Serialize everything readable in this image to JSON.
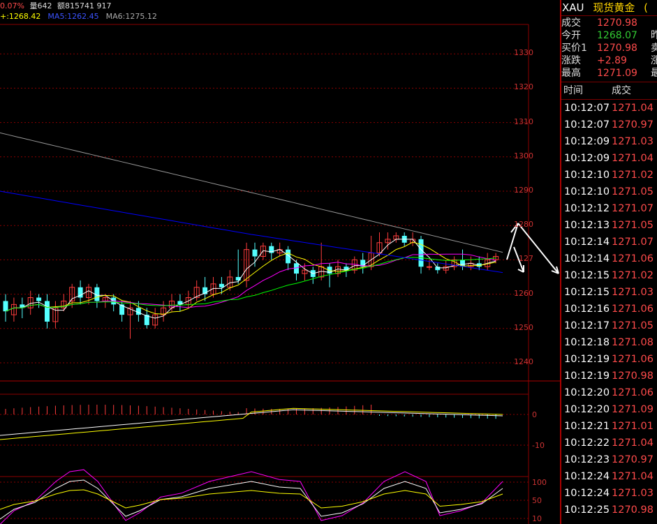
{
  "colors": {
    "up": "#ff3c3c",
    "down": "#54ffff",
    "ma5": "#ffffff",
    "ma10": "#ffff00",
    "ma20": "#ff00ff",
    "ma30": "#00ff00",
    "ma60": "#0000ff",
    "ma120": "#999999",
    "grid": "#8b0000",
    "quote_up": "#ff4b4b",
    "quote_down": "#33cc33",
    "title": "#ffd400"
  },
  "topbar": {
    "change": "0.07%",
    "volume": "量642",
    "amount": "额815741 917"
  },
  "ma_legend": [
    {
      "label": "+:1268.42",
      "color": "#ffff00"
    },
    {
      "label": "MA5:1262.45",
      "color": "#3b53ff"
    },
    {
      "label": "MA6:1275.12",
      "color": "#aaaaaa"
    }
  ],
  "chart_data": {
    "type": "candlestick",
    "yticks": [
      "1330",
      "1320",
      "1310",
      "1300",
      "1290",
      "1280",
      "127",
      "1260",
      "1250",
      "1240"
    ],
    "ylim": [
      1235,
      1335
    ],
    "macd_ticks": [
      "0",
      "-10"
    ],
    "kdj_ticks": [
      "100",
      "50",
      "10"
    ],
    "candles": [
      [
        1258,
        1255,
        1260,
        1252
      ],
      [
        1254,
        1257,
        1259,
        1252
      ],
      [
        1257,
        1256,
        1259,
        1253
      ],
      [
        1256,
        1259,
        1261,
        1254
      ],
      [
        1259,
        1258,
        1260,
        1256
      ],
      [
        1258,
        1252,
        1260,
        1250
      ],
      [
        1252,
        1256,
        1258,
        1250
      ],
      [
        1256,
        1258,
        1260,
        1255
      ],
      [
        1258,
        1262,
        1263,
        1256
      ],
      [
        1262,
        1259,
        1264,
        1257
      ],
      [
        1259,
        1262,
        1263,
        1257
      ],
      [
        1262,
        1258,
        1263,
        1256
      ],
      [
        1258,
        1259,
        1260,
        1256
      ],
      [
        1259,
        1257,
        1260,
        1255
      ],
      [
        1257,
        1254,
        1258,
        1252
      ],
      [
        1254,
        1256,
        1258,
        1247
      ],
      [
        1256,
        1254,
        1258,
        1252
      ],
      [
        1254,
        1251,
        1256,
        1250
      ],
      [
        1251,
        1254,
        1256,
        1250
      ],
      [
        1254,
        1256,
        1258,
        1252
      ],
      [
        1256,
        1258,
        1260,
        1255
      ],
      [
        1258,
        1257,
        1260,
        1255
      ],
      [
        1257,
        1259,
        1261,
        1256
      ],
      [
        1259,
        1262,
        1264,
        1258
      ],
      [
        1262,
        1260,
        1265,
        1258
      ],
      [
        1260,
        1263,
        1265,
        1259
      ],
      [
        1263,
        1262,
        1265,
        1260
      ],
      [
        1262,
        1265,
        1267,
        1261
      ],
      [
        1265,
        1264,
        1273,
        1263
      ],
      [
        1264,
        1273,
        1275,
        1262
      ],
      [
        1273,
        1271,
        1275,
        1268
      ],
      [
        1271,
        1274,
        1275,
        1270
      ],
      [
        1274,
        1272,
        1275,
        1270
      ],
      [
        1272,
        1273,
        1275,
        1271
      ],
      [
        1273,
        1269,
        1274,
        1267
      ],
      [
        1269,
        1266,
        1270,
        1264
      ],
      [
        1266,
        1267,
        1269,
        1264
      ],
      [
        1267,
        1265,
        1268,
        1263
      ],
      [
        1265,
        1268,
        1275,
        1264
      ],
      [
        1268,
        1266,
        1269,
        1262
      ],
      [
        1266,
        1268,
        1270,
        1265
      ],
      [
        1268,
        1267,
        1269,
        1265
      ],
      [
        1267,
        1270,
        1271,
        1266
      ],
      [
        1270,
        1268,
        1272,
        1266
      ],
      [
        1268,
        1272,
        1277,
        1267
      ],
      [
        1272,
        1275,
        1278,
        1271
      ],
      [
        1275,
        1276,
        1278,
        1273
      ],
      [
        1276,
        1277,
        1278,
        1275
      ],
      [
        1277,
        1275,
        1278,
        1274
      ],
      [
        1275,
        1276,
        1278,
        1274
      ],
      [
        1276,
        1268,
        1277,
        1266
      ],
      [
        1268,
        1268,
        1270,
        1267
      ],
      [
        1268,
        1267,
        1269,
        1266
      ],
      [
        1267,
        1268,
        1270,
        1266
      ],
      [
        1268,
        1270,
        1271,
        1267
      ],
      [
        1270,
        1268,
        1273,
        1267
      ],
      [
        1268,
        1269,
        1271,
        1267
      ],
      [
        1269,
        1268,
        1271,
        1267
      ],
      [
        1268,
        1270,
        1272,
        1267
      ],
      [
        1270,
        1271,
        1272,
        1269
      ]
    ]
  },
  "quote": {
    "symbol": "XAU",
    "name": "现货黄金",
    "name_ext": "(",
    "rows": [
      {
        "label": "成交",
        "value": "1270.98",
        "color": "#ff4b4b",
        "ext": ""
      },
      {
        "label": "今开",
        "value": "1268.07",
        "color": "#33cc33",
        "ext": "昨"
      },
      {
        "label": "买价1",
        "value": "1270.98",
        "color": "#ff4b4b",
        "ext": "卖"
      },
      {
        "label": "涨跌",
        "value": "+2.89",
        "color": "#ff4b4b",
        "ext": "涨"
      },
      {
        "label": "最高",
        "value": "1271.09",
        "color": "#ff4b4b",
        "ext": "最"
      }
    ]
  },
  "trades": {
    "col_time": "时间",
    "col_price": "成交",
    "rows": [
      {
        "time": "10:12:07",
        "price": "1271.04"
      },
      {
        "time": "10:12:07",
        "price": "1270.97"
      },
      {
        "time": "10:12:09",
        "price": "1271.03"
      },
      {
        "time": "10:12:09",
        "price": "1271.04"
      },
      {
        "time": "10:12:10",
        "price": "1271.02"
      },
      {
        "time": "10:12:10",
        "price": "1271.05"
      },
      {
        "time": "10:12:12",
        "price": "1271.07"
      },
      {
        "time": "10:12:13",
        "price": "1271.05"
      },
      {
        "time": "10:12:14",
        "price": "1271.07"
      },
      {
        "time": "10:12:14",
        "price": "1271.06"
      },
      {
        "time": "10:12:15",
        "price": "1271.02"
      },
      {
        "time": "10:12:15",
        "price": "1271.03"
      },
      {
        "time": "10:12:16",
        "price": "1271.06"
      },
      {
        "time": "10:12:17",
        "price": "1271.05"
      },
      {
        "time": "10:12:18",
        "price": "1271.08"
      },
      {
        "time": "10:12:19",
        "price": "1271.06"
      },
      {
        "time": "10:12:19",
        "price": "1270.98"
      },
      {
        "time": "10:12:20",
        "price": "1271.06"
      },
      {
        "time": "10:12:20",
        "price": "1271.09"
      },
      {
        "time": "10:12:21",
        "price": "1271.01"
      },
      {
        "time": "10:12:22",
        "price": "1271.04"
      },
      {
        "time": "10:12:23",
        "price": "1270.97"
      },
      {
        "time": "10:12:24",
        "price": "1271.04"
      },
      {
        "time": "10:12:24",
        "price": "1271.03"
      },
      {
        "time": "10:12:25",
        "price": "1270.98"
      }
    ]
  }
}
